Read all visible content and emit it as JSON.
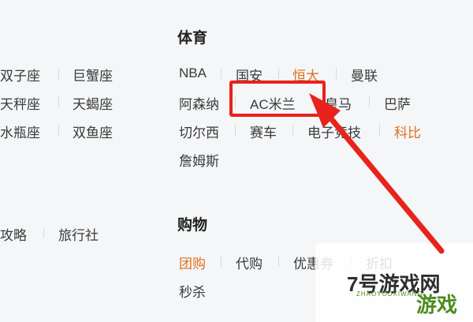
{
  "left_column": {
    "row1": [
      "双子座",
      "巨蟹座"
    ],
    "row2": [
      "天秤座",
      "天蝎座"
    ],
    "row3": [
      "水瓶座",
      "双鱼座"
    ],
    "row4": [
      "攻略",
      "旅行社"
    ]
  },
  "sports": {
    "title": "体育",
    "row1": [
      "NBA",
      "国安",
      "恒大",
      "曼联"
    ],
    "row2": [
      "阿森纳",
      "AC米兰",
      "皇马",
      "巴萨"
    ],
    "row3": [
      "切尔西",
      "赛车",
      "电子竞技",
      "科比"
    ],
    "row4": [
      "詹姆斯"
    ]
  },
  "shopping": {
    "title": "购物",
    "row1": [
      "团购",
      "代购",
      "优惠券",
      "折扣"
    ],
    "row2": [
      "秒杀"
    ]
  },
  "watermark": {
    "logo": "7号游戏网",
    "subtitle": "ZHAOYOUXIWANG",
    "badge": "游戏"
  },
  "colors": {
    "accent": "#e0701c",
    "annotation": "#e8231b",
    "background": "#f4f6f8"
  }
}
